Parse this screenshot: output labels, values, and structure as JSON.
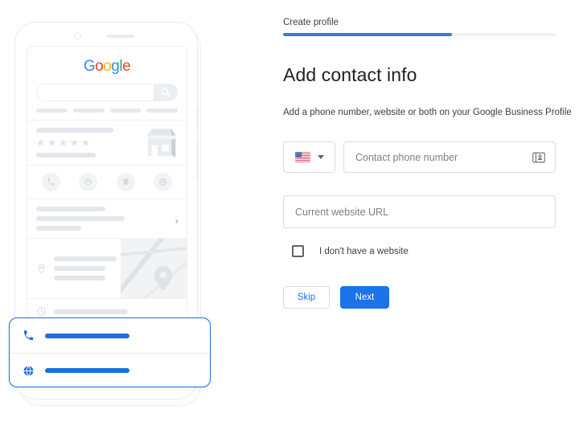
{
  "wizard": {
    "step_label": "Create profile",
    "progress_percent": 62,
    "progress_color": "#3b78dc",
    "track_color": "#eef1f8"
  },
  "form": {
    "title": "Add contact info",
    "description": "Add a phone number, website or both on your Google Business Profile",
    "country_selector": {
      "flag": "us-flag-icon",
      "value": "US",
      "caret": "chevron-down-icon"
    },
    "phone_field": {
      "placeholder": "Contact phone number",
      "value": "",
      "trailing_icon": "contacts-icon"
    },
    "website_field": {
      "placeholder": "Current website URL",
      "value": ""
    },
    "no_website_checkbox": {
      "label": "I don't have a website",
      "checked": false
    },
    "buttons": {
      "skip": "Skip",
      "next": "Next"
    },
    "accent_color": "#1a73e8"
  },
  "illustration": {
    "name": "phone-mockup-business-profile",
    "google_logo": {
      "letters": [
        {
          "char": "G",
          "color": "#4285F4"
        },
        {
          "char": "o",
          "color": "#EA4335"
        },
        {
          "char": "o",
          "color": "#FBBC05"
        },
        {
          "char": "g",
          "color": "#4285F4"
        },
        {
          "char": "l",
          "color": "#34A853"
        },
        {
          "char": "e",
          "color": "#EA4335"
        }
      ]
    },
    "search_icon": "search-icon",
    "rating_stars": 5,
    "storefront_icon": "storefront-icon",
    "action_icons": [
      "phone-icon",
      "directions-icon",
      "bookmark-icon",
      "website-globe-icon"
    ],
    "place_icon": "location-pin-icon",
    "map_pin_icon": "map-pin-icon",
    "hours_icon": "clock-icon",
    "chevron_icon": "chevron-right-icon",
    "callout": {
      "highlight_color": "#1a73e8",
      "rows": [
        {
          "icon": "phone-icon",
          "bar_label": "phone-number-placeholder-bar"
        },
        {
          "icon": "website-globe-icon",
          "bar_label": "website-url-placeholder-bar"
        }
      ]
    }
  }
}
